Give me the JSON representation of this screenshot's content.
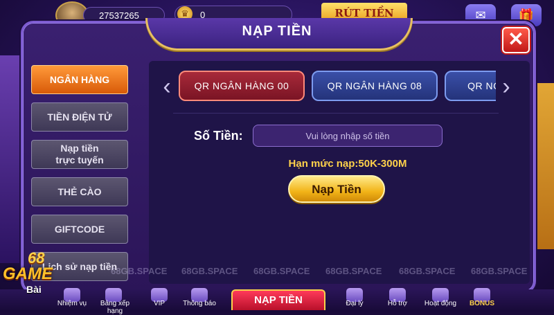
{
  "header": {
    "user_id": "27537265",
    "coins": "0",
    "coin_icon": "crown-icon",
    "withdraw_label": "RÚT TIỀN",
    "top_icons": [
      "mail-icon",
      "gift-icon"
    ]
  },
  "modal": {
    "title": "NẠP TIỀN",
    "close_label": "✕"
  },
  "sidebar": {
    "items": [
      {
        "label": "NGÂN HÀNG",
        "active": true
      },
      {
        "label": "TIỀN ĐIỆN TỬ",
        "active": false
      },
      {
        "label": "Nạp tiền\ntrực tuyến",
        "active": false
      },
      {
        "label": "THẺ CÀO",
        "active": false
      },
      {
        "label": "GIFTCODE",
        "active": false
      },
      {
        "label": "Lịch sử nạp tiền",
        "active": false
      }
    ]
  },
  "bank_tabs": [
    {
      "label": "QR NGÂN HÀNG 00",
      "active": true
    },
    {
      "label": "QR NGÂN HÀNG 08",
      "active": false
    },
    {
      "label": "QR NGÂN HÀNG",
      "active": false
    }
  ],
  "form": {
    "amount_label": "Số Tiền:",
    "amount_placeholder": "Vui lòng nhập số tiền",
    "amount_value": "",
    "limit_text": "Hạn mức nạp:50K-300M",
    "deposit_button": "Nạp Tiền"
  },
  "watermark": "68GB.SPACE",
  "bottom_nav": {
    "items": [
      "Nhiệm vụ",
      "Bảng xếp hạng",
      "VIP",
      "Thông báo",
      "Đại lý",
      "Hỗ trợ",
      "Hoạt động",
      "BONUS"
    ],
    "main": "NẠP TIỀN"
  },
  "logo": {
    "num": "68",
    "game": "GAME",
    "bai": "Bài"
  },
  "colors": {
    "active_tab": "#ff8a3a",
    "accent_gold": "#ffd24a",
    "bank_active": "#a82a3a",
    "bank_inactive": "#3a4fa8"
  }
}
